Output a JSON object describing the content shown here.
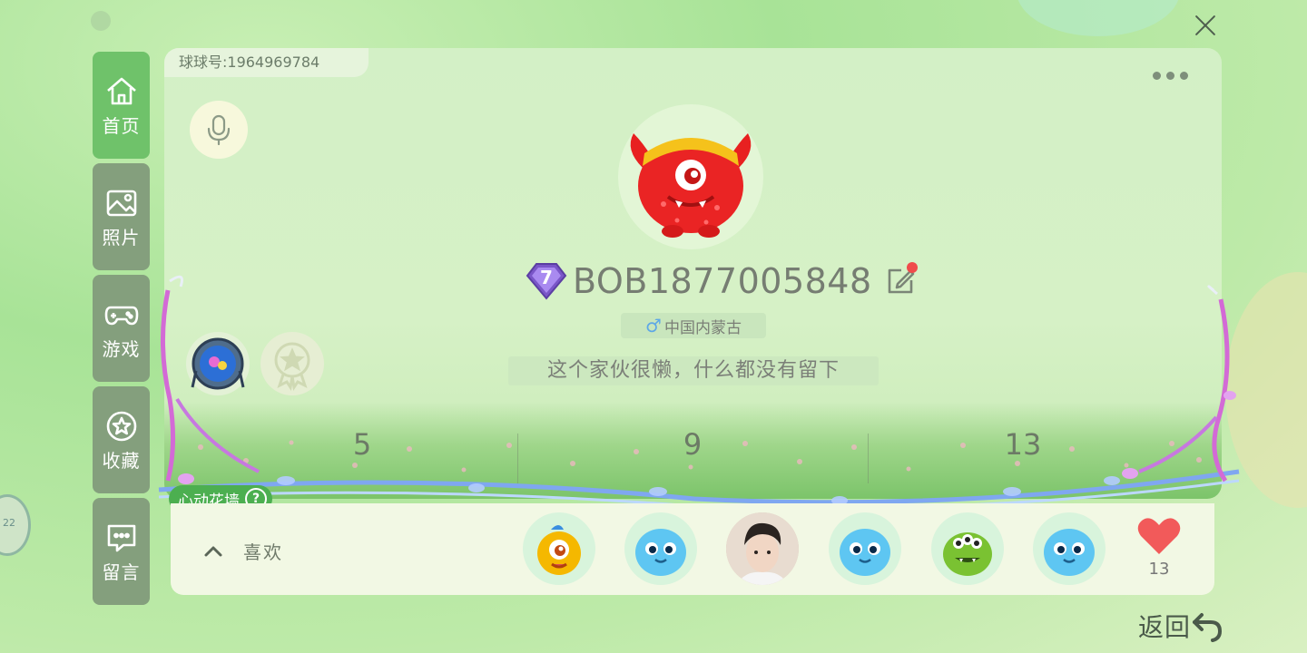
{
  "profile": {
    "id_label": "球球号:1964969784",
    "nickname": "BOB1877005848",
    "level": "7",
    "gender_symbol": "♂",
    "location": "中国内蒙古",
    "signature": "这个家伙很懒，什么都没有留下"
  },
  "nav": {
    "items": [
      {
        "label": "首页",
        "icon": "home-icon"
      },
      {
        "label": "照片",
        "icon": "image-icon"
      },
      {
        "label": "游戏",
        "icon": "gamepad-icon"
      },
      {
        "label": "收藏",
        "icon": "star-icon"
      },
      {
        "label": "留言",
        "icon": "message-icon"
      }
    ]
  },
  "stats": [
    {
      "value": "5"
    },
    {
      "value": "9"
    },
    {
      "value": "13"
    }
  ],
  "flower_wall": {
    "label": "心动花墙",
    "help": "?"
  },
  "likes": {
    "label": "喜欢",
    "count": "13",
    "likers": [
      {
        "icon": "yellow-monster-avatar"
      },
      {
        "icon": "blue-monster-avatar"
      },
      {
        "icon": "user-photo-avatar"
      },
      {
        "icon": "blue-monster-avatar"
      },
      {
        "icon": "green-monster-avatar"
      },
      {
        "icon": "blue-monster-avatar"
      }
    ]
  },
  "footer": {
    "back_label": "返回"
  },
  "side_badge": {
    "text": "22"
  },
  "colors": {
    "accent_green": "#6fc26a",
    "nav_gray": "#849f7d",
    "tag_green": "#4caf50",
    "heart_red": "#f25a5a",
    "level_purple": "#8c63d8"
  }
}
